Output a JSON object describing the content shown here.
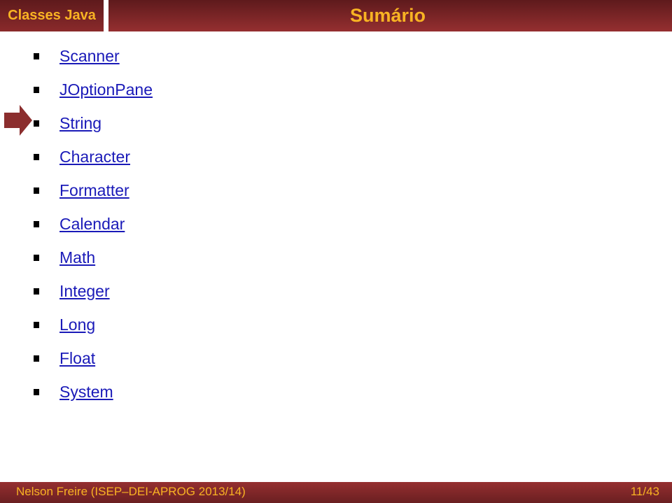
{
  "header": {
    "section_label": "Classes Java",
    "title": "Sumário"
  },
  "current_item_index": 2,
  "list": {
    "items": [
      {
        "label": "Scanner"
      },
      {
        "label": "JOptionPane"
      },
      {
        "label": "String"
      },
      {
        "label": "Character"
      },
      {
        "label": "Formatter"
      },
      {
        "label": "Calendar"
      },
      {
        "label": "Math"
      },
      {
        "label": "Integer"
      },
      {
        "label": "Long"
      },
      {
        "label": "Float"
      },
      {
        "label": "System"
      }
    ]
  },
  "footer": {
    "author": "Nelson Freire (ISEP–DEI-APROG 2013/14)",
    "page": "11/43"
  },
  "colors": {
    "header_bg": "#8a2a2b",
    "accent_text": "#f8b323",
    "link": "#1a1ab8",
    "arrow": "#8b2e2e"
  }
}
